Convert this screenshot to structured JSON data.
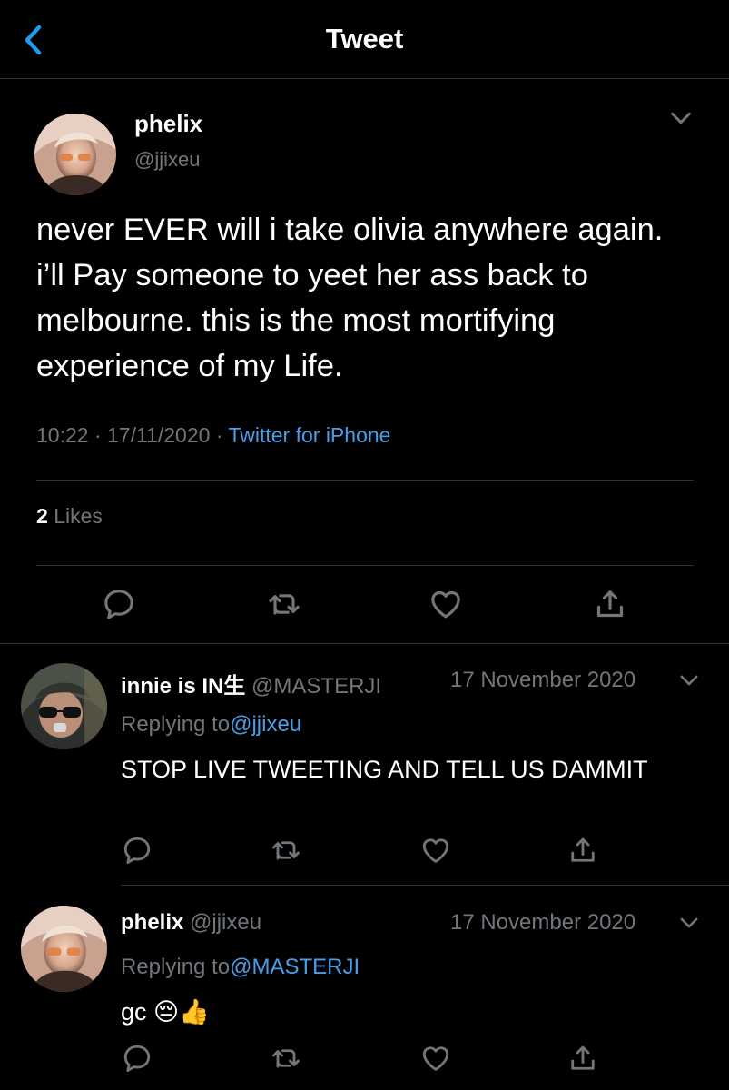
{
  "header": {
    "title": "Tweet"
  },
  "tweet": {
    "name": "phelix",
    "handle": "@jjixeu",
    "text": "never EVER will i take olivia anywhere again. i’ll Pay someone to yeet her ass back to melbourne. this is the most mortifying experience of my Life.",
    "time": "10:22",
    "sep1": "·",
    "date": "17/11/2020",
    "sep2": "·",
    "source": "Twitter for iPhone",
    "likes_count": "2",
    "likes_label": "Likes"
  },
  "replies": [
    {
      "name": "innie is IN生",
      "handle": "@MASTERJI",
      "date": "17 November 2020",
      "replying_label": "Replying to",
      "replying_handle": "@jjixeu",
      "text": "STOP LIVE TWEETING AND TELL US DAMMIT"
    },
    {
      "name": "phelix",
      "handle": "@jjixeu",
      "date": "17 November 2020",
      "replying_label": "Replying to",
      "replying_handle": "@MASTERJI",
      "text": "gc 😔👍"
    }
  ],
  "icons": {
    "back": "chevron-left-icon",
    "menu": "chevron-down-icon",
    "reply": "comment-icon",
    "retweet": "retweet-icon",
    "like": "heart-icon",
    "share": "share-icon"
  },
  "colors": {
    "accent": "#1d9bf0",
    "link": "#4a9ee8",
    "muted": "#71767b",
    "divider": "#2f3336",
    "background": "#000000"
  }
}
